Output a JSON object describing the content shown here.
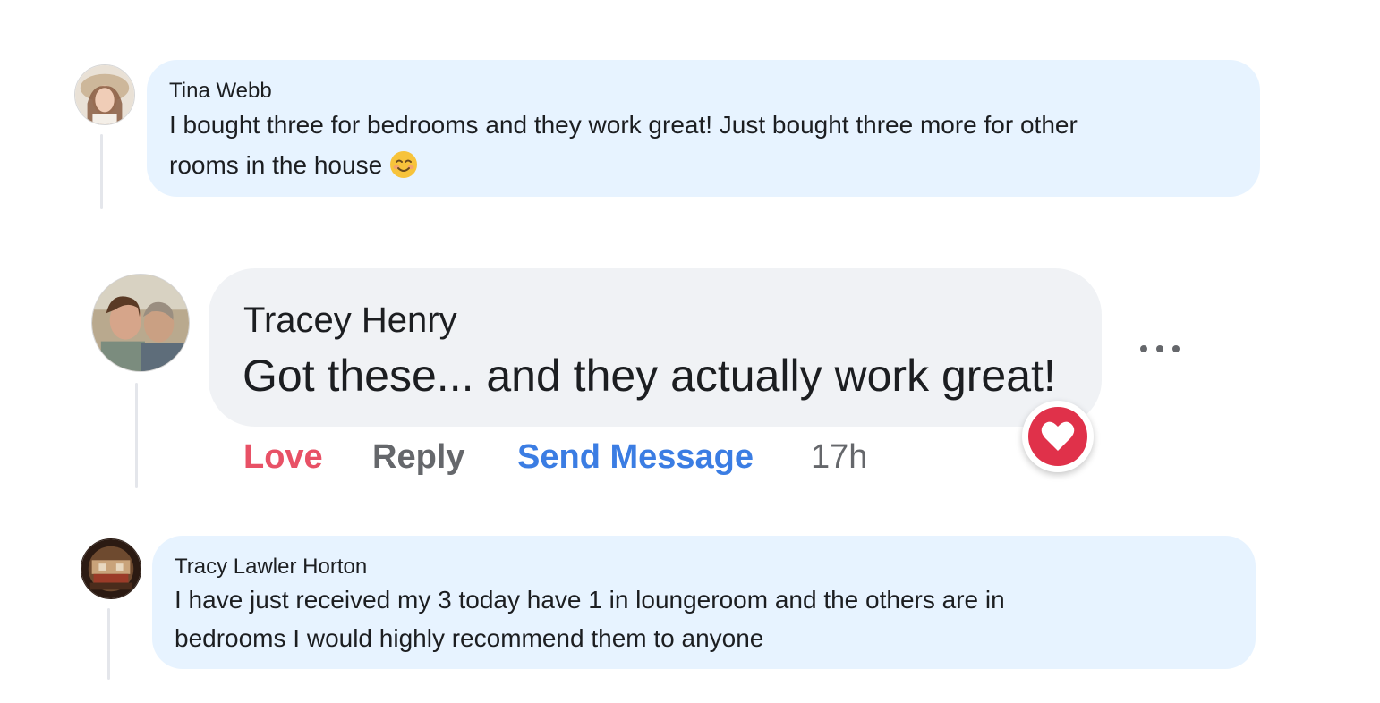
{
  "comments": [
    {
      "author": "Tina Webb",
      "lines": [
        "I bought three for bedrooms and they work great! Just bought three more for other",
        "rooms in the house"
      ],
      "emoji": "smiling-face-icon"
    },
    {
      "author": "Tracey Henry",
      "text": "Got these... and they actually work great!",
      "actions": {
        "love": "Love",
        "reply": "Reply",
        "send_message": "Send Message",
        "time": "17h"
      },
      "reaction": "heart-icon",
      "more": "more-options-icon"
    },
    {
      "author": "Tracy Lawler Horton",
      "lines": [
        "I have just received my 3 today have 1 in loungeroom and the others are in",
        "bedrooms I would highly recommend them to anyone"
      ]
    }
  ],
  "colors": {
    "bubble_blue": "#e7f3ff",
    "bubble_gray": "#f0f2f5",
    "love": "#e85166",
    "link_blue": "#3b7de3",
    "muted": "#65676b",
    "heart": "#e0314a"
  }
}
